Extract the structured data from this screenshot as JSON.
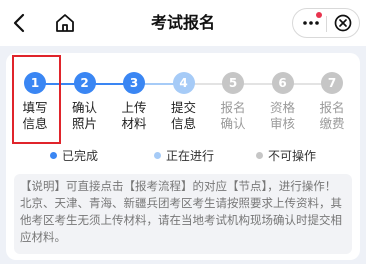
{
  "header": {
    "title": "考试报名",
    "back_icon": "chevron-left-icon",
    "home_icon": "home-icon",
    "more_icon": "more-dots-icon",
    "close_icon": "close-circle-icon"
  },
  "colors": {
    "done": "#3a86f3",
    "in_progress": "#a6cbf7",
    "disabled": "#c6c6c6",
    "highlight": "#e0242b"
  },
  "steps": [
    {
      "number": "1",
      "label": "填写\n信息",
      "state": "done"
    },
    {
      "number": "2",
      "label": "确认\n照片",
      "state": "done"
    },
    {
      "number": "3",
      "label": "上传\n材料",
      "state": "done"
    },
    {
      "number": "4",
      "label": "提交\n信息",
      "state": "in_progress"
    },
    {
      "number": "5",
      "label": "报名\n确认",
      "state": "disabled"
    },
    {
      "number": "6",
      "label": "资格\n审核",
      "state": "disabled"
    },
    {
      "number": "7",
      "label": "报名\n缴费",
      "state": "disabled"
    }
  ],
  "legend": {
    "done": "已完成",
    "in_progress": "正在进行",
    "disabled": "不可操作"
  },
  "note": "【说明】可直接点击【报考流程】的对应【节点】，进行操作！ 北京、天津、青海、新疆兵团考区考生请按照要求上传资料，其他考区考生无须上传材料，请在当地考试机构现场确认时提交相应材料。"
}
